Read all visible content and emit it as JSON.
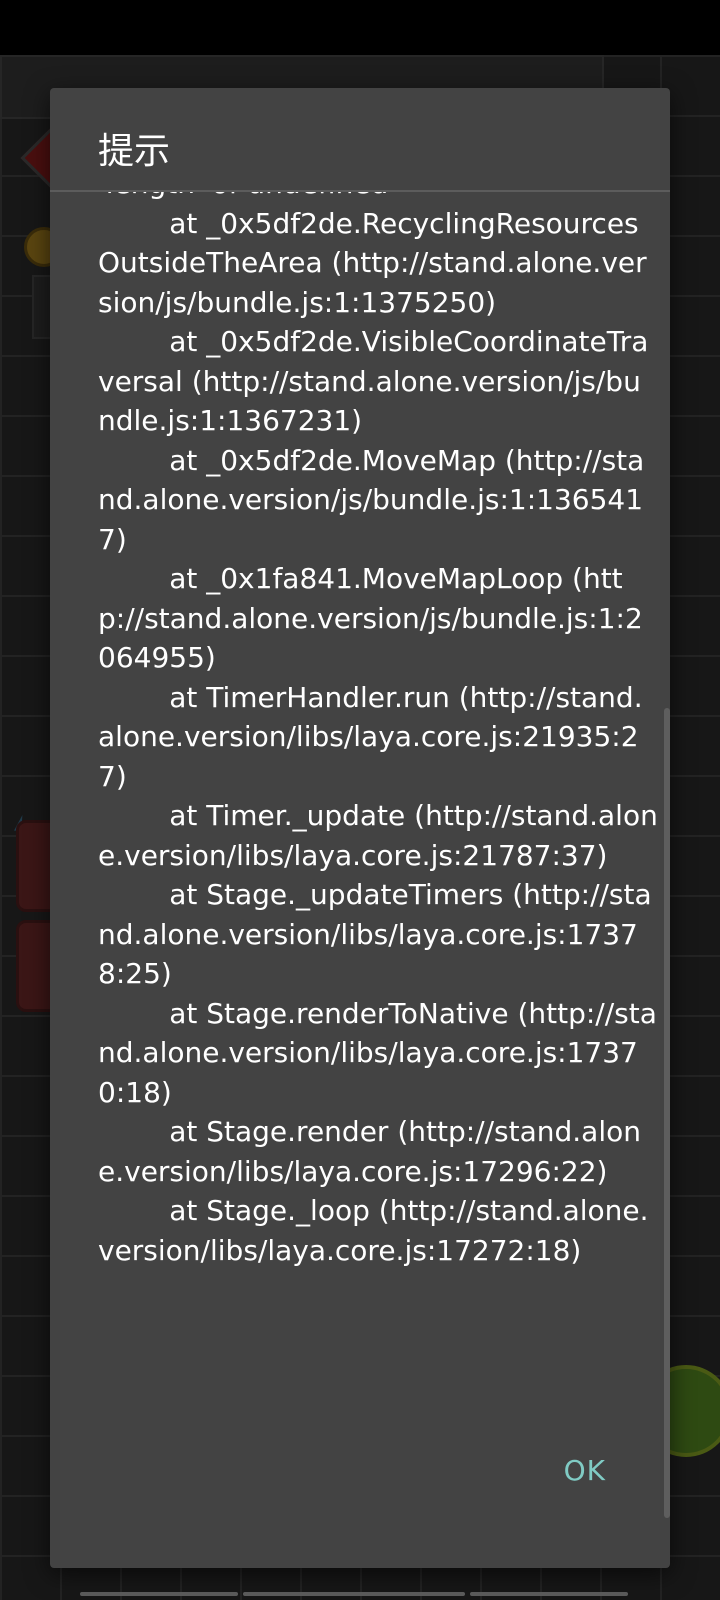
{
  "dialog": {
    "title": "提示",
    "message": "'length' of undefined\n        at _0x5df2de.RecyclingResourcesOutsideTheArea (http://stand.alone.version/js/bundle.js:1:1375250)\n        at _0x5df2de.VisibleCoordinateTraversal (http://stand.alone.version/js/bundle.js:1:1367231)\n        at _0x5df2de.MoveMap (http://stand.alone.version/js/bundle.js:1:1365417)\n        at _0x1fa841.MoveMapLoop (http://stand.alone.version/js/bundle.js:1:2064955)\n        at TimerHandler.run (http://stand.alone.version/libs/laya.core.js:21935:27)\n        at Timer._update (http://stand.alone.version/libs/laya.core.js:21787:37)\n        at Stage._updateTimers (http://stand.alone.version/libs/laya.core.js:17378:25)\n        at Stage.renderToNative (http://stand.alone.version/libs/laya.core.js:17370:18)\n        at Stage.render (http://stand.alone.version/libs/laya.core.js:17296:22)\n        at Stage._loop (http://stand.alone.version/libs/laya.core.js:17272:18)",
    "ok_label": "OK"
  },
  "colors": {
    "dialog_background": "#434343",
    "text": "#ffffff",
    "accent": "#80cbc4",
    "scrim": "#000000"
  }
}
